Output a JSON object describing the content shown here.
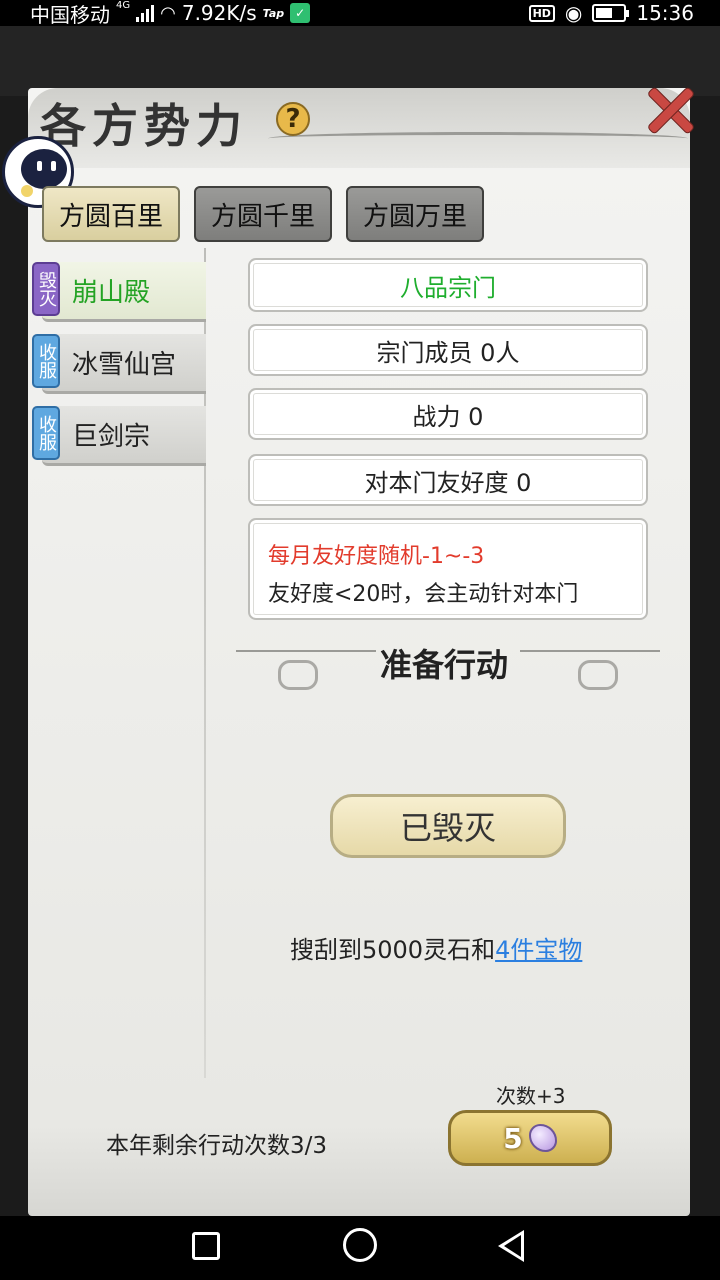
{
  "status_bar": {
    "carrier": "中国移动",
    "network": "4G",
    "speed": "7.92K/s",
    "tap_icon": "Tap",
    "time": "15:36",
    "hd": "HD"
  },
  "dialog": {
    "title": "各方势力",
    "help_icon": "?",
    "tabs": [
      {
        "label": "方圆百里",
        "active": true
      },
      {
        "label": "方圆千里",
        "active": false
      },
      {
        "label": "方圆万里",
        "active": false
      }
    ],
    "factions": [
      {
        "badge": "毁灭",
        "name": "崩山殿",
        "badge_color": "#8a66c6",
        "active": true
      },
      {
        "badge": "收服",
        "name": "冰雪仙宫",
        "badge_color": "#5fa8e0",
        "active": false
      },
      {
        "badge": "收服",
        "name": "巨剑宗",
        "badge_color": "#5fa8e0",
        "active": false
      }
    ],
    "details": {
      "rank": "八品宗门",
      "members": "宗门成员 0人",
      "power": "战力 0",
      "friendship": "对本门友好度 0",
      "note_line1": "每月友好度随机-1~-3",
      "note_line2": "友好度<20时，会主动针对本门"
    },
    "action_title": "准备行动",
    "destroyed_button": "已毁灭",
    "loot_text": "搜刮到5000灵石和",
    "loot_link": "4件宝物",
    "remaining_actions": "本年剩余行动次数3/3",
    "times_label": "次数+3",
    "times_cost": "5"
  },
  "colors": {
    "active_green": "#1fae2e",
    "warning_red": "#e23b2c",
    "link_blue": "#2b7fe0"
  }
}
